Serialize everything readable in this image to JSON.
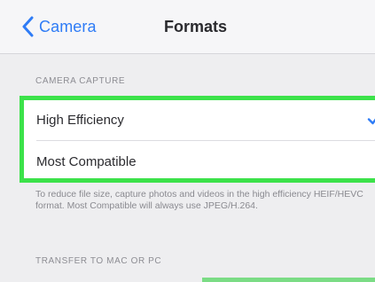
{
  "navbar": {
    "back_label": "Camera",
    "title": "Formats"
  },
  "sections": {
    "capture_header": "CAMERA CAPTURE",
    "transfer_header": "TRANSFER TO MAC OR PC"
  },
  "options": [
    {
      "label": "High Efficiency",
      "selected": true
    },
    {
      "label": "Most Compatible",
      "selected": false
    }
  ],
  "description": "To reduce file size, capture photos and videos in the high efficiency HEIF/HEVC format. Most Compatible will always use JPEG/H.264.",
  "colors": {
    "accent": "#2f7cf6",
    "highlight": "#3ce24a"
  },
  "icons": {
    "back": "chevron-left-icon",
    "selected": "checkmark-icon"
  }
}
